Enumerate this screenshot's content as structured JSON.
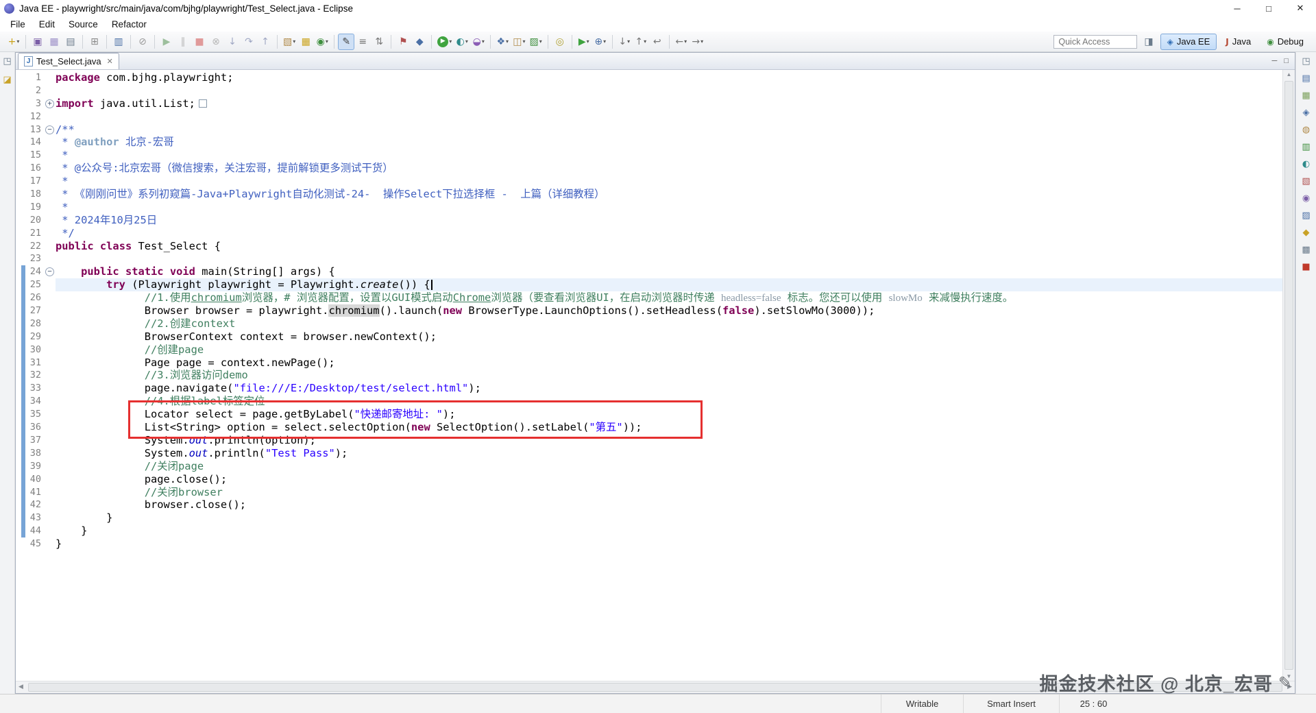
{
  "window": {
    "title": "Java EE - playwright/src/main/java/com/bjhg/playwright/Test_Select.java - Eclipse",
    "controls": {
      "minimize": "─",
      "maximize": "□",
      "close": "✕"
    }
  },
  "menus": [
    "File",
    "Edit",
    "Source",
    "Refactor"
  ],
  "toolbar": {
    "quick_access_placeholder": "Quick Access",
    "dropdown_glyph": "▾",
    "open_perspective_glyph": "◨",
    "groups": [
      [
        {
          "name": "new-wizard-button",
          "glyph": "+",
          "color": "#caa21a",
          "dropdown": true
        }
      ],
      [
        {
          "name": "save-button",
          "glyph": "▣",
          "color": "#7b5ea7"
        },
        {
          "name": "save-all-button",
          "glyph": "▦",
          "color": "#9b8ec7"
        },
        {
          "name": "print-button",
          "glyph": "▤",
          "color": "#6b7b8c"
        }
      ],
      [
        {
          "name": "build-all-button",
          "glyph": "⊞",
          "color": "#8a8a8a"
        }
      ],
      [
        {
          "name": "open-console-button",
          "glyph": "▥",
          "color": "#4a6fa5"
        }
      ],
      [
        {
          "name": "skip-breakpoints-button",
          "glyph": "⊘",
          "color": "#9a9a9a"
        }
      ],
      [
        {
          "name": "resume-button",
          "glyph": "▶",
          "color": "#9dbf9d"
        },
        {
          "name": "suspend-button",
          "glyph": "∥",
          "color": "#b8b8b8"
        },
        {
          "name": "terminate-button",
          "glyph": "■",
          "color": "#e09a9a"
        },
        {
          "name": "disconnect-button",
          "glyph": "⊗",
          "color": "#b8b8b8"
        },
        {
          "name": "step-into-button",
          "glyph": "↓",
          "color": "#a0a8c4"
        },
        {
          "name": "step-over-button",
          "glyph": "↷",
          "color": "#a0a8c4"
        },
        {
          "name": "step-return-button",
          "glyph": "↑",
          "color": "#a0a8c4"
        }
      ],
      [
        {
          "name": "new-java-project-button",
          "glyph": "▧",
          "color": "#b08a4a",
          "dropdown": true
        },
        {
          "name": "new-package-button",
          "glyph": "▦",
          "color": "#caa21a"
        },
        {
          "name": "new-class-button",
          "glyph": "◉",
          "color": "#3f8f3f",
          "dropdown": true
        }
      ],
      [
        {
          "name": "mark-occurrences-toggle",
          "glyph": "✎",
          "color": "#444444",
          "active": true
        },
        {
          "name": "format-source-button",
          "glyph": "≡",
          "color": "#777777"
        },
        {
          "name": "sort-members-button",
          "glyph": "⇅",
          "color": "#777777"
        }
      ],
      [
        {
          "name": "task-flag-button",
          "glyph": "⚑",
          "color": "#b05050"
        },
        {
          "name": "bookmark-button",
          "glyph": "◆",
          "color": "#4a6fa5"
        }
      ],
      [
        {
          "name": "run-button",
          "glyph": "▶",
          "color": "#ffffff",
          "bg": "#3fa33f",
          "dropdown": true
        },
        {
          "name": "coverage-button",
          "glyph": "◐",
          "color": "#2e8b8b",
          "dropdown": true
        },
        {
          "name": "profile-button",
          "glyph": "◒",
          "color": "#8a5cb5",
          "dropdown": true
        }
      ],
      [
        {
          "name": "new-server-button",
          "glyph": "❖",
          "color": "#4a6fa5",
          "dropdown": true
        },
        {
          "name": "new-servlet-button",
          "glyph": "◫",
          "color": "#b08a4a",
          "dropdown": true
        },
        {
          "name": "new-web-project-button",
          "glyph": "▨",
          "color": "#3f8f3f",
          "dropdown": true
        }
      ],
      [
        {
          "name": "search-button",
          "glyph": "◎",
          "color": "#b0a030"
        }
      ],
      [
        {
          "name": "external-tools-button",
          "glyph": "▶",
          "color": "#3fa33f",
          "dropdown": true
        },
        {
          "name": "web-browser-button",
          "glyph": "⊕",
          "color": "#4a6fa5",
          "dropdown": true
        }
      ],
      [
        {
          "name": "next-annotation-button",
          "glyph": "↓",
          "color": "#777777",
          "dropdown": true
        },
        {
          "name": "previous-annotation-button",
          "glyph": "↑",
          "color": "#777777",
          "dropdown": true
        },
        {
          "name": "last-edit-location-button",
          "glyph": "↩",
          "color": "#777777"
        }
      ],
      [
        {
          "name": "back-button",
          "glyph": "←",
          "color": "#777777",
          "dropdown": true
        },
        {
          "name": "forward-button",
          "glyph": "→",
          "color": "#777777",
          "dropdown": true
        }
      ]
    ],
    "perspectives": [
      {
        "label": "Java EE",
        "glyph": "◈",
        "color": "#2f6db5",
        "active": true
      },
      {
        "label": "Java",
        "glyph": "J",
        "color": "#b5452f",
        "active": false
      },
      {
        "label": "Debug",
        "glyph": "◉",
        "color": "#3f8f3f",
        "active": false
      }
    ]
  },
  "tabs": [
    {
      "label": "Test_Select.java",
      "active": true,
      "file_icon_glyph": "J",
      "close_glyph": "✕"
    }
  ],
  "tabbar_actions": [
    {
      "name": "minimize-editor-button",
      "glyph": "─"
    },
    {
      "name": "maximize-editor-button",
      "glyph": "□"
    }
  ],
  "left_strip": [
    {
      "name": "restore-views-icon",
      "glyph": "◳",
      "color": "#6b7b8c"
    },
    {
      "name": "minimized-project-explorer-icon",
      "glyph": "◪",
      "color": "#c9a227"
    }
  ],
  "right_strip": [
    {
      "name": "restore-views-icon",
      "glyph": "◳",
      "color": "#6b7b8c"
    },
    {
      "name": "minimized-view-icon-1",
      "glyph": "▤",
      "color": "#4a6fa5"
    },
    {
      "name": "minimized-view-icon-2",
      "glyph": "▦",
      "color": "#7ba05b"
    },
    {
      "name": "minimized-view-icon-3",
      "glyph": "◈",
      "color": "#4a6fa5"
    },
    {
      "name": "minimized-view-icon-4",
      "glyph": "◍",
      "color": "#b08a4a"
    },
    {
      "name": "minimized-view-icon-5",
      "glyph": "▥",
      "color": "#3f8f3f"
    },
    {
      "name": "minimized-view-icon-6",
      "glyph": "◐",
      "color": "#2e8b8b"
    },
    {
      "name": "minimized-view-icon-7",
      "glyph": "▧",
      "color": "#b05050"
    },
    {
      "name": "minimized-view-icon-8",
      "glyph": "◉",
      "color": "#7b5ea7"
    },
    {
      "name": "minimized-view-icon-9",
      "glyph": "▨",
      "color": "#4a6fa5"
    },
    {
      "name": "minimized-view-icon-10",
      "glyph": "◆",
      "color": "#c9a227"
    },
    {
      "name": "minimized-view-icon-11",
      "glyph": "▩",
      "color": "#6b7b8c"
    },
    {
      "name": "minimized-view-icon-12",
      "glyph": "■",
      "color": "#c0392b"
    }
  ],
  "editor": {
    "fold_plus": "+",
    "fold_minus": "−",
    "scroll": {
      "up": "▲",
      "down": "▼",
      "left": "◀",
      "right": "▶"
    },
    "lines": [
      {
        "n": "1",
        "tokens": [
          [
            "kw",
            "package"
          ],
          [
            "pl",
            " com.bjhg.playwright;"
          ]
        ]
      },
      {
        "n": "2",
        "tokens": []
      },
      {
        "n": "3",
        "fold": "plus",
        "collapsed": true,
        "tokens": [
          [
            "kw",
            "import"
          ],
          [
            "pl",
            " java.util.List;"
          ]
        ]
      },
      {
        "n": "12",
        "tokens": []
      },
      {
        "n": "13",
        "fold": "minus",
        "tokens": [
          [
            "jdoc",
            "/**"
          ]
        ]
      },
      {
        "n": "14",
        "tokens": [
          [
            "jdoc",
            " * "
          ],
          [
            "jtag",
            "@author"
          ],
          [
            "jdoc",
            " 北京-宏哥"
          ]
        ]
      },
      {
        "n": "15",
        "tokens": [
          [
            "jdoc",
            " *"
          ]
        ]
      },
      {
        "n": "16",
        "tokens": [
          [
            "jdoc",
            " * @公众号:北京宏哥（微信搜索，关注宏哥，提前解锁更多测试干货）"
          ]
        ]
      },
      {
        "n": "17",
        "tokens": [
          [
            "jdoc",
            " *"
          ]
        ]
      },
      {
        "n": "18",
        "tokens": [
          [
            "jdoc",
            " * 《刚刚问世》系列初窥篇-Java+Playwright自动化测试-24-  操作Select下拉选择框 -  上篇（详细教程）"
          ]
        ]
      },
      {
        "n": "19",
        "tokens": [
          [
            "jdoc",
            " *"
          ]
        ]
      },
      {
        "n": "20",
        "tokens": [
          [
            "jdoc",
            " * 2024年10月25日"
          ]
        ]
      },
      {
        "n": "21",
        "tokens": [
          [
            "jdoc",
            " */"
          ]
        ]
      },
      {
        "n": "22",
        "tokens": [
          [
            "kw",
            "public"
          ],
          [
            "pl",
            " "
          ],
          [
            "kw",
            "class"
          ],
          [
            "pl",
            " Test_Select {"
          ]
        ]
      },
      {
        "n": "23",
        "tokens": []
      },
      {
        "n": "24",
        "fold": "minus",
        "changed": true,
        "tokens": [
          [
            "pl",
            "    "
          ],
          [
            "kw",
            "public"
          ],
          [
            "pl",
            " "
          ],
          [
            "kw",
            "static"
          ],
          [
            "pl",
            " "
          ],
          [
            "kw",
            "void"
          ],
          [
            "pl",
            " main(String[] args) {"
          ]
        ]
      },
      {
        "n": "25",
        "changed": true,
        "current": true,
        "cursor": true,
        "tokens": [
          [
            "pl",
            "        "
          ],
          [
            "kw",
            "try"
          ],
          [
            "pl",
            " (Playwright playwright = Playwright."
          ],
          [
            "stm",
            "create"
          ],
          [
            "pl",
            "()) {"
          ]
        ]
      },
      {
        "n": "26",
        "changed": true,
        "tokens": [
          [
            "com",
            "              //1.使用"
          ],
          [
            "comu",
            "chromium"
          ],
          [
            "com",
            "浏览器，# 浏览器配置，设置以GUI模式启动"
          ],
          [
            "comu",
            "Chrome"
          ],
          [
            "com",
            "浏览器（要查看浏览器UI，在启动浏览器时传递 "
          ],
          [
            "cem",
            "headless=false"
          ],
          [
            "com",
            " 标志。您还可以使用 "
          ],
          [
            "cem",
            "slowMo"
          ],
          [
            "com",
            " 来减慢执行速度。"
          ]
        ]
      },
      {
        "n": "27",
        "changed": true,
        "tokens": [
          [
            "pl",
            "              Browser browser = playwright."
          ],
          [
            "occ",
            "chromium"
          ],
          [
            "pl",
            "().launch("
          ],
          [
            "kw",
            "new"
          ],
          [
            "pl",
            " BrowserType.LaunchOptions().setHeadless("
          ],
          [
            "kw",
            "false"
          ],
          [
            "pl",
            ").setSlowMo(3000));"
          ]
        ]
      },
      {
        "n": "28",
        "changed": true,
        "tokens": [
          [
            "com",
            "              //2.创建context"
          ]
        ]
      },
      {
        "n": "29",
        "changed": true,
        "tokens": [
          [
            "pl",
            "              BrowserContext context = browser.newContext();"
          ]
        ]
      },
      {
        "n": "30",
        "changed": true,
        "tokens": [
          [
            "com",
            "              //创建page"
          ]
        ]
      },
      {
        "n": "31",
        "changed": true,
        "tokens": [
          [
            "pl",
            "              Page page = context.newPage();"
          ]
        ]
      },
      {
        "n": "32",
        "changed": true,
        "tokens": [
          [
            "com",
            "              //3.浏览器访问demo"
          ]
        ]
      },
      {
        "n": "33",
        "changed": true,
        "tokens": [
          [
            "pl",
            "              page.navigate("
          ],
          [
            "str",
            "\"file:///E:/Desktop/test/select.html\""
          ],
          [
            "pl",
            ");"
          ]
        ]
      },
      {
        "n": "34",
        "changed": true,
        "tokens": [
          [
            "com",
            "              //4.根据label标签定位"
          ]
        ]
      },
      {
        "n": "35",
        "changed": true,
        "tokens": [
          [
            "pl",
            "              Locator select = page.getByLabel("
          ],
          [
            "str",
            "\"快递邮寄地址: \""
          ],
          [
            "pl",
            ");"
          ]
        ]
      },
      {
        "n": "36",
        "changed": true,
        "tokens": [
          [
            "pl",
            "              List<String> option = select.selectOption("
          ],
          [
            "kw",
            "new"
          ],
          [
            "pl",
            " SelectOption().setLabel("
          ],
          [
            "str",
            "\"第五\""
          ],
          [
            "pl",
            "));"
          ]
        ]
      },
      {
        "n": "37",
        "changed": true,
        "tokens": [
          [
            "pl",
            "              System."
          ],
          [
            "fld",
            "out"
          ],
          [
            "pl",
            ".println(option);"
          ]
        ]
      },
      {
        "n": "38",
        "changed": true,
        "tokens": [
          [
            "pl",
            "              System."
          ],
          [
            "fld",
            "out"
          ],
          [
            "pl",
            ".println("
          ],
          [
            "str",
            "\"Test Pass\""
          ],
          [
            "pl",
            ");"
          ]
        ]
      },
      {
        "n": "39",
        "changed": true,
        "tokens": [
          [
            "com",
            "              //关闭page"
          ]
        ]
      },
      {
        "n": "40",
        "changed": true,
        "tokens": [
          [
            "pl",
            "              page.close();"
          ]
        ]
      },
      {
        "n": "41",
        "changed": true,
        "tokens": [
          [
            "com",
            "              //关闭browser"
          ]
        ]
      },
      {
        "n": "42",
        "changed": true,
        "tokens": [
          [
            "pl",
            "              browser.close();"
          ]
        ]
      },
      {
        "n": "43",
        "changed": true,
        "tokens": [
          [
            "pl",
            "        }"
          ]
        ]
      },
      {
        "n": "44",
        "changed": true,
        "tokens": [
          [
            "pl",
            "    }"
          ]
        ]
      },
      {
        "n": "45",
        "tokens": [
          [
            "pl",
            "}"
          ]
        ]
      }
    ]
  },
  "status": {
    "writable": "Writable",
    "insert_mode": "Smart Insert",
    "caret": "25 : 60"
  },
  "watermark": {
    "text": "掘金技术社区 @ 北京_宏哥",
    "icon": "✎"
  },
  "colors": {
    "keyword": "#7f0055",
    "string": "#2a00ff",
    "comment": "#3f7f5f",
    "javadoc": "#3f5fbf",
    "current_line": "#e9f2fc",
    "change_bar": "#77a4d6",
    "red_box": "#e53030",
    "perspective_active_bg": "#c2dbf7"
  }
}
